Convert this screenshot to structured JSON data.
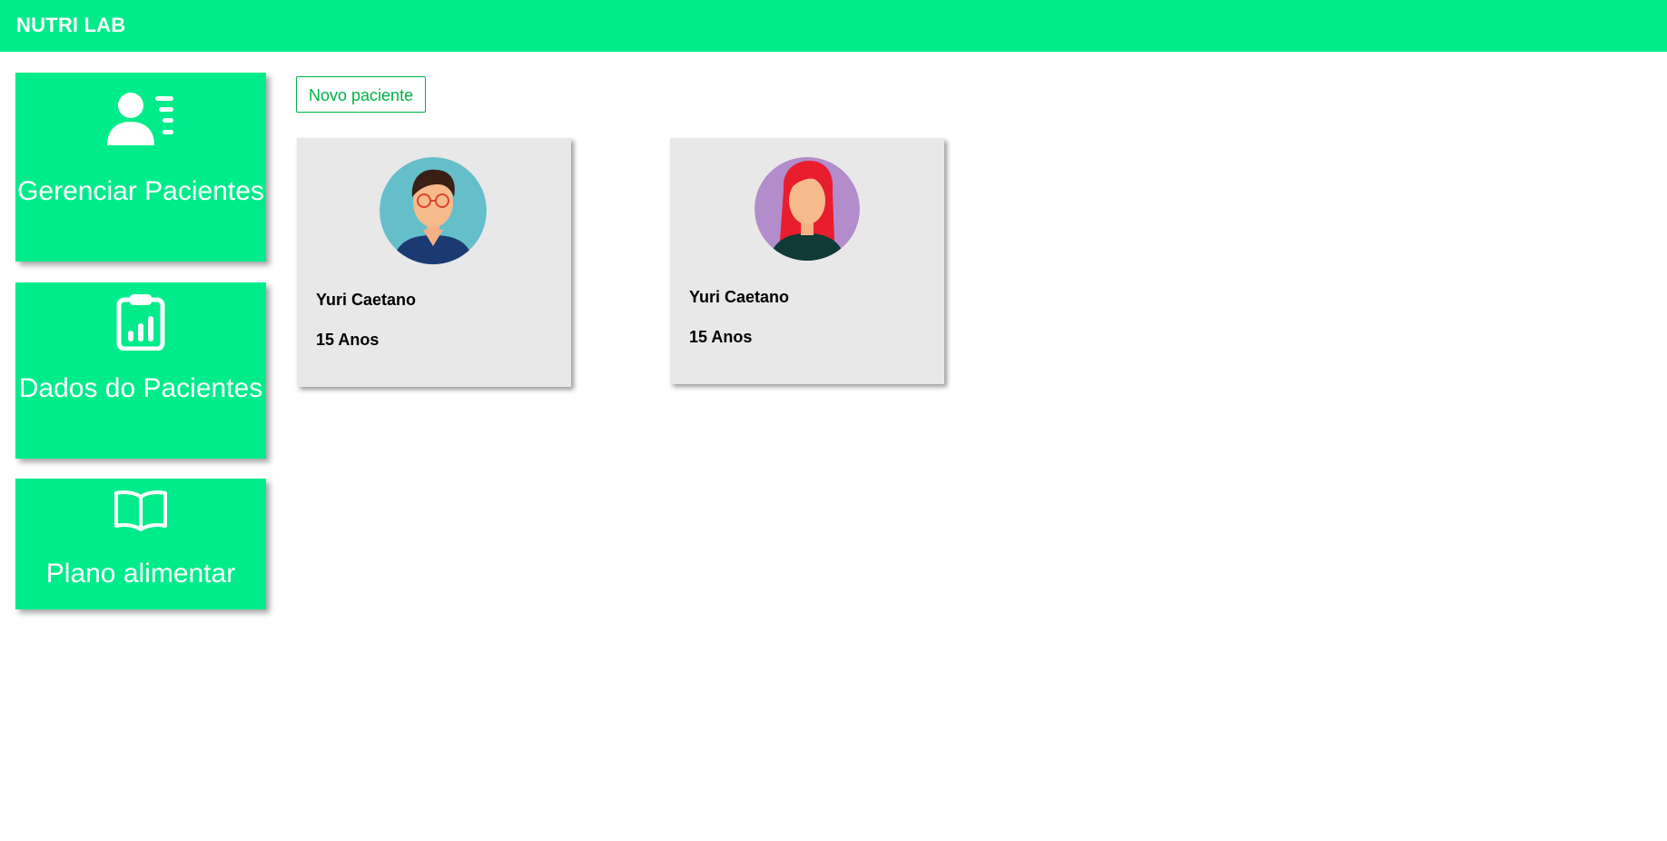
{
  "app": {
    "brand": "NUTRI LAB",
    "accent_color": "#00ec8b",
    "button_color": "#00b347"
  },
  "sidebar": {
    "items": [
      {
        "label": "Gerenciar Pacientes",
        "icon": "user-list-icon"
      },
      {
        "label": "Dados do Pacientes",
        "icon": "clipboard-chart-icon"
      },
      {
        "label": "Plano alimentar",
        "icon": "open-book-icon"
      }
    ]
  },
  "main": {
    "new_patient_label": "Novo paciente",
    "patients": [
      {
        "name": "Yuri Caetano",
        "age": "15 Anos",
        "avatar": "male-avatar-glasses"
      },
      {
        "name": "Yuri Caetano",
        "age": "15 Anos",
        "avatar": "female-avatar-red-hair"
      }
    ]
  }
}
